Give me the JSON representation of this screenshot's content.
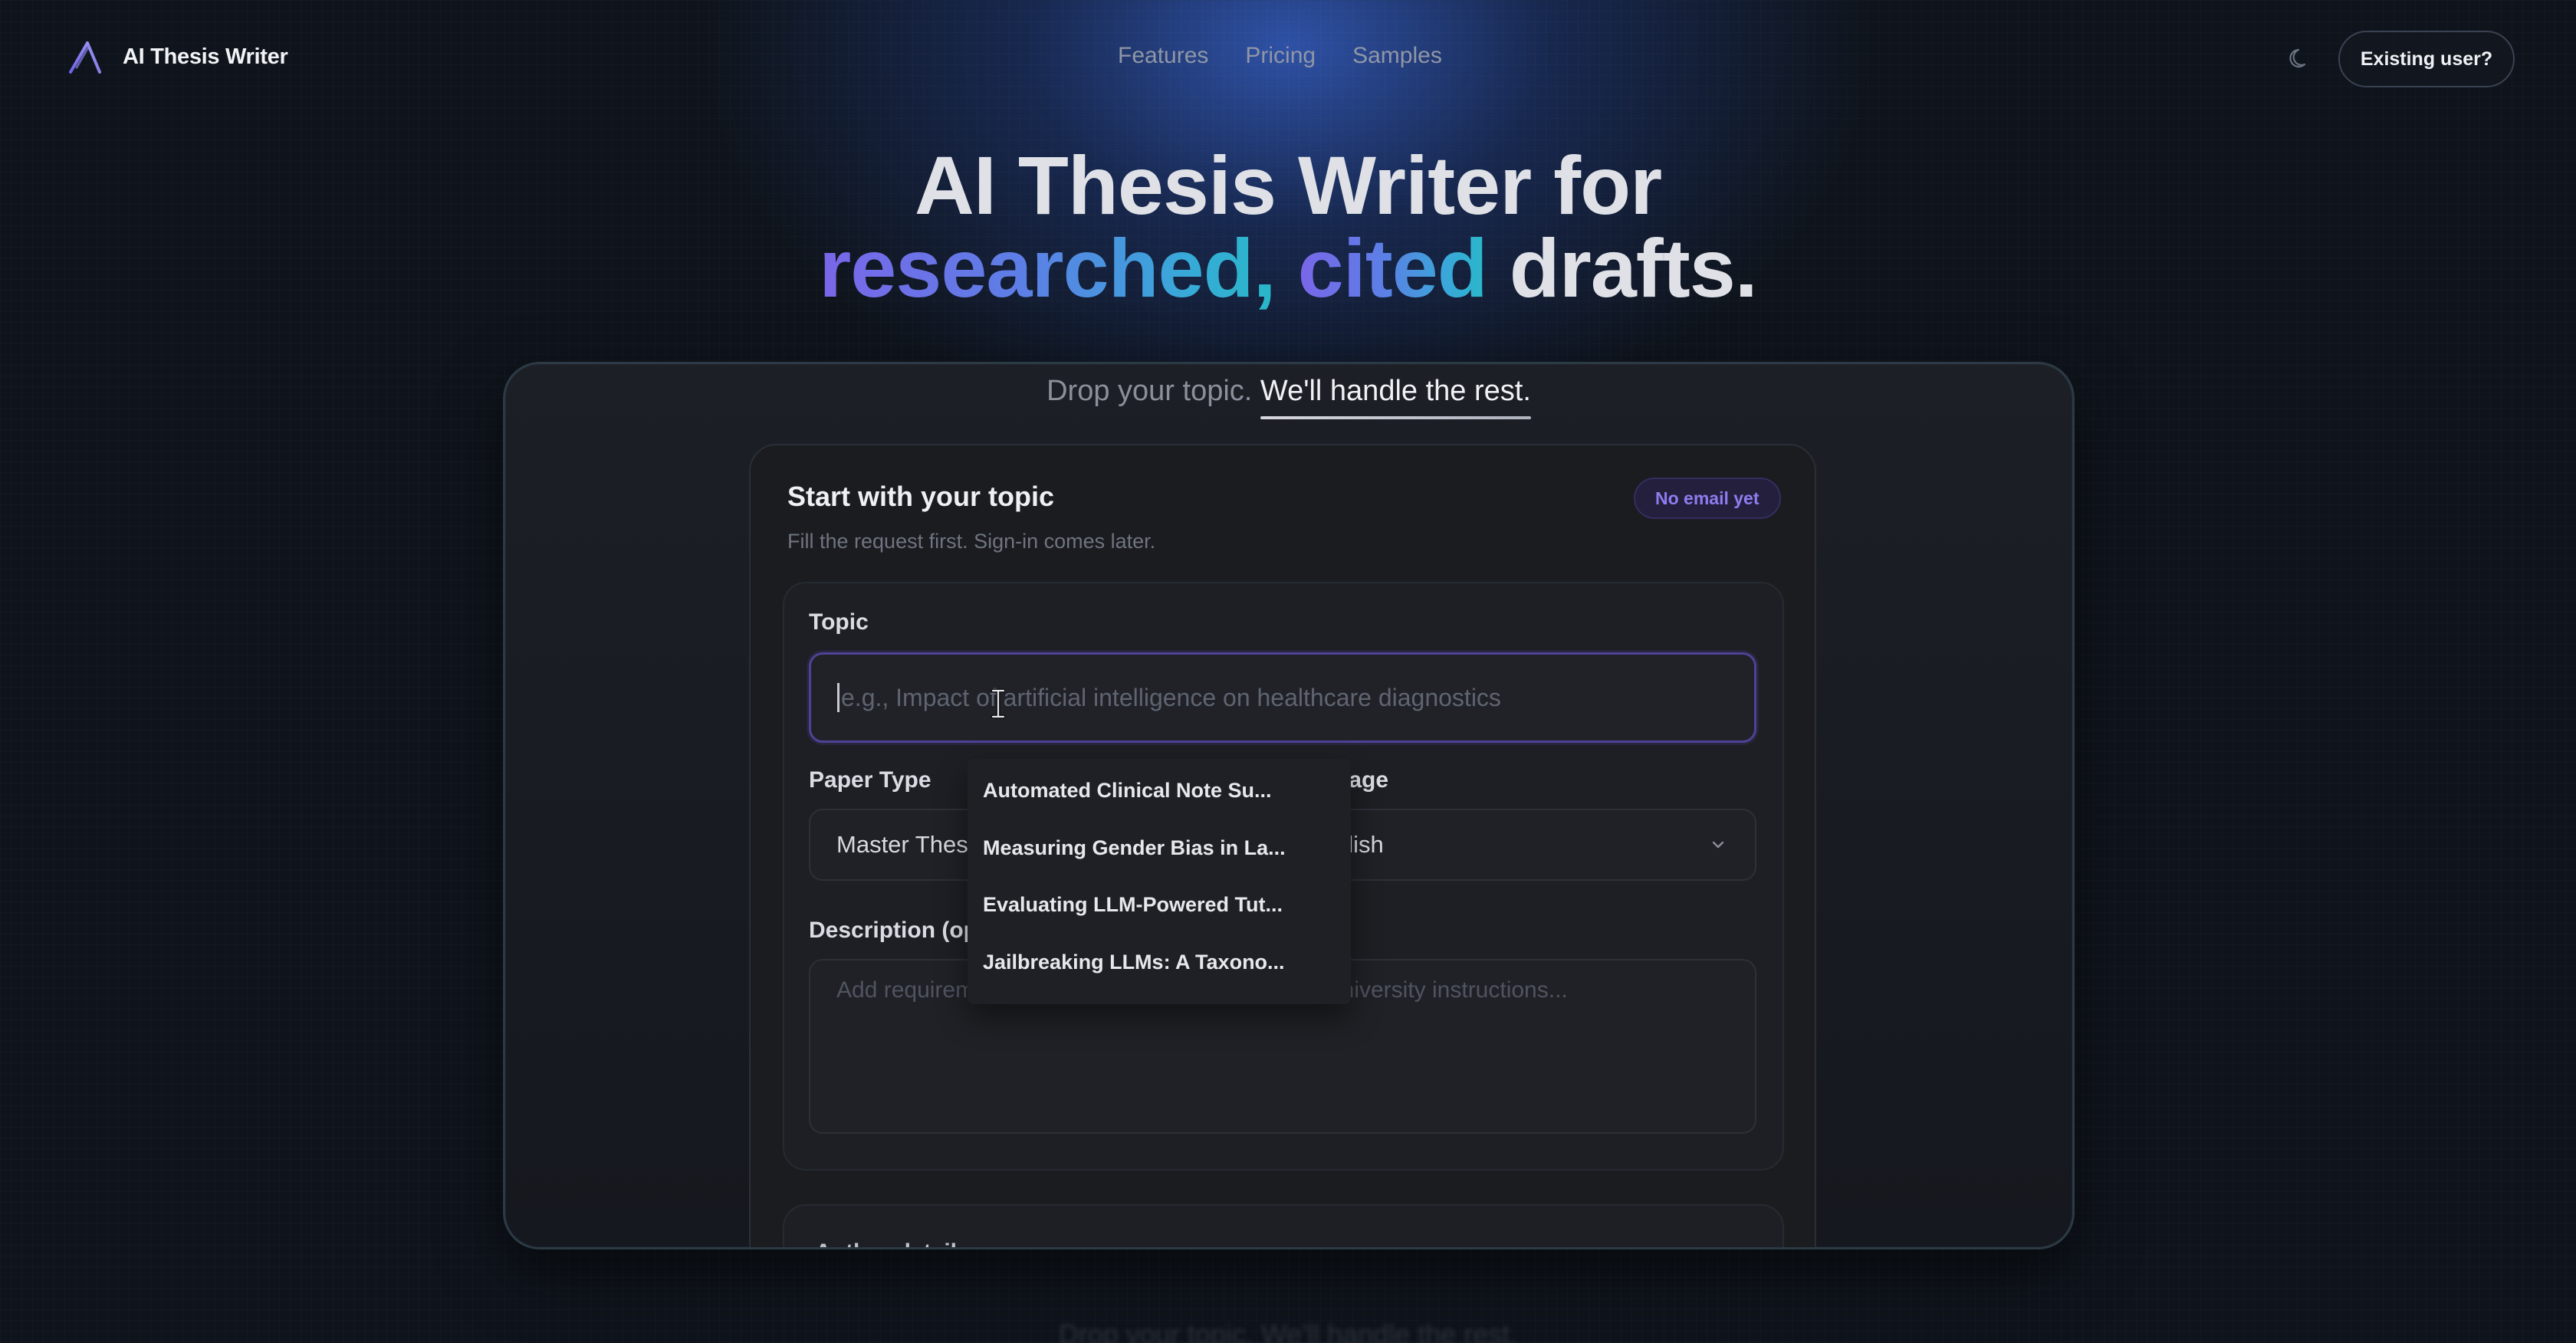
{
  "nav": {
    "brand_name": "AI Thesis Writer",
    "links": [
      "Features",
      "Pricing",
      "Samples"
    ],
    "existing_user_label": "Existing user?",
    "theme_icon": "moon-icon"
  },
  "hero": {
    "line1": "AI Thesis Writer for",
    "line2_grad1": "researched,",
    "line2_grad2": "cited",
    "line2_plain": "drafts."
  },
  "tagline": {
    "part1": "Drop your topic.",
    "part2": "We'll handle the rest."
  },
  "card": {
    "title": "Start with your topic",
    "subtitle": "Fill the request first. Sign-in comes later.",
    "badge": "No email yet"
  },
  "form": {
    "topic_label": "Topic",
    "topic_placeholder": "e.g., Impact of artificial intelligence on healthcare diagnostics",
    "paper_type_label": "Paper Type",
    "paper_type_value": "Master Thes",
    "language_label": "uage",
    "language_value": "glish",
    "description_label": "Description (op",
    "description_placeholder": "Add requirements, focus areas, citation style, or university instructions..."
  },
  "author_section": {
    "label": "Author details"
  },
  "dropdown": {
    "items": [
      "Automated Clinical Note Su...",
      "Measuring Gender Bias in La...",
      "Evaluating LLM-Powered Tut...",
      "Jailbreaking LLMs: A Taxono..."
    ]
  },
  "colors": {
    "accent_purple": "#7a66e8",
    "accent_teal": "#29b8c9",
    "badge_text": "#8f7cf0"
  }
}
